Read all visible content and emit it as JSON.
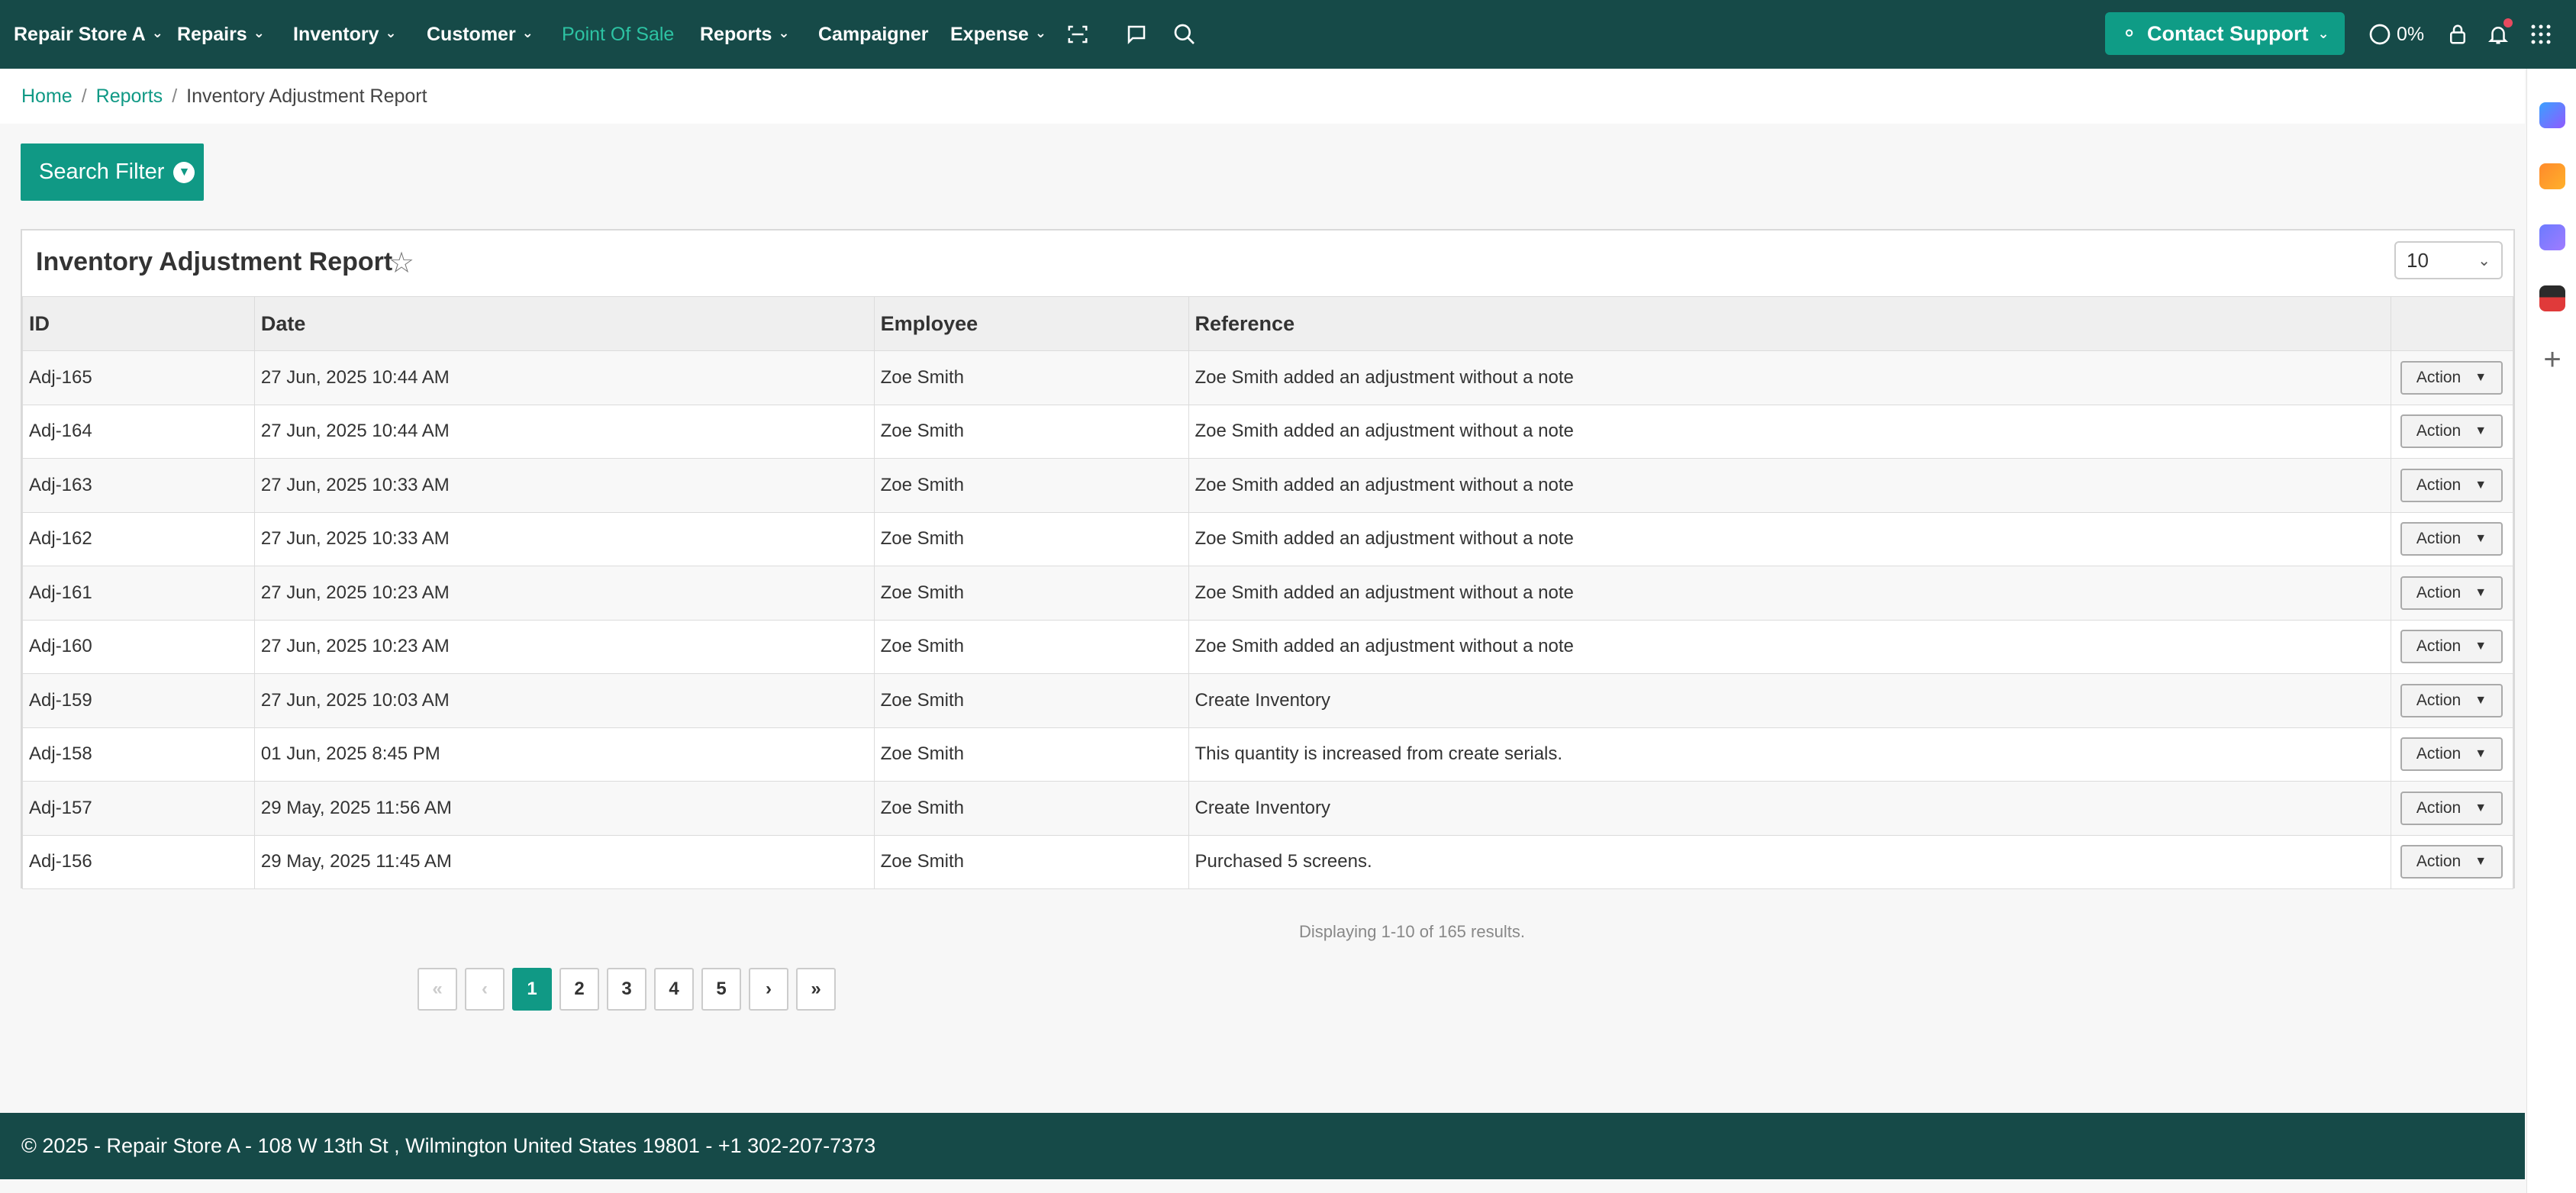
{
  "nav": {
    "store": "Repair Store A",
    "repairs": "Repairs",
    "inventory": "Inventory",
    "customer": "Customer",
    "pos": "Point Of Sale",
    "reports": "Reports",
    "campaigner": "Campaigner",
    "expense": "Expense",
    "contact_support": "Contact Support",
    "progress": "0%"
  },
  "breadcrumb": {
    "home": "Home",
    "reports": "Reports",
    "current": "Inventory Adjustment Report"
  },
  "search_filter": "Search Filter",
  "report": {
    "title": "Inventory Adjustment Report",
    "page_size": "10",
    "columns": [
      "ID",
      "Date",
      "Employee",
      "Reference"
    ],
    "action_label": "Action",
    "rows": [
      {
        "id": "Adj-165",
        "date": "27 Jun, 2025 10:44 AM",
        "employee": "Zoe Smith",
        "reference": "Zoe Smith added an adjustment without a note"
      },
      {
        "id": "Adj-164",
        "date": "27 Jun, 2025 10:44 AM",
        "employee": "Zoe Smith",
        "reference": "Zoe Smith added an adjustment without a note"
      },
      {
        "id": "Adj-163",
        "date": "27 Jun, 2025 10:33 AM",
        "employee": "Zoe Smith",
        "reference": "Zoe Smith added an adjustment without a note"
      },
      {
        "id": "Adj-162",
        "date": "27 Jun, 2025 10:33 AM",
        "employee": "Zoe Smith",
        "reference": "Zoe Smith added an adjustment without a note"
      },
      {
        "id": "Adj-161",
        "date": "27 Jun, 2025 10:23 AM",
        "employee": "Zoe Smith",
        "reference": "Zoe Smith added an adjustment without a note"
      },
      {
        "id": "Adj-160",
        "date": "27 Jun, 2025 10:23 AM",
        "employee": "Zoe Smith",
        "reference": "Zoe Smith added an adjustment without a note"
      },
      {
        "id": "Adj-159",
        "date": "27 Jun, 2025 10:03 AM",
        "employee": "Zoe Smith",
        "reference": "Create Inventory"
      },
      {
        "id": "Adj-158",
        "date": "01 Jun, 2025 8:45 PM",
        "employee": "Zoe Smith",
        "reference": "This quantity is increased from create serials."
      },
      {
        "id": "Adj-157",
        "date": "29 May, 2025 11:56 AM",
        "employee": "Zoe Smith",
        "reference": "Create Inventory"
      },
      {
        "id": "Adj-156",
        "date": "29 May, 2025 11:45 AM",
        "employee": "Zoe Smith",
        "reference": "Purchased 5 screens."
      }
    ],
    "summary": "Displaying 1-10 of 165 results."
  },
  "pagination": {
    "first": "«",
    "prev": "‹",
    "pages": [
      "1",
      "2",
      "3",
      "4",
      "5"
    ],
    "next": "›",
    "last": "»",
    "current": "1"
  },
  "footer": "© 2025 - Repair Store A - 108 W 13th St , Wilmington United States 19801 - +1 302-207-7373",
  "colors": {
    "nav_bg": "#164a48",
    "accent": "#109985",
    "active_link": "#2dc3a3"
  }
}
